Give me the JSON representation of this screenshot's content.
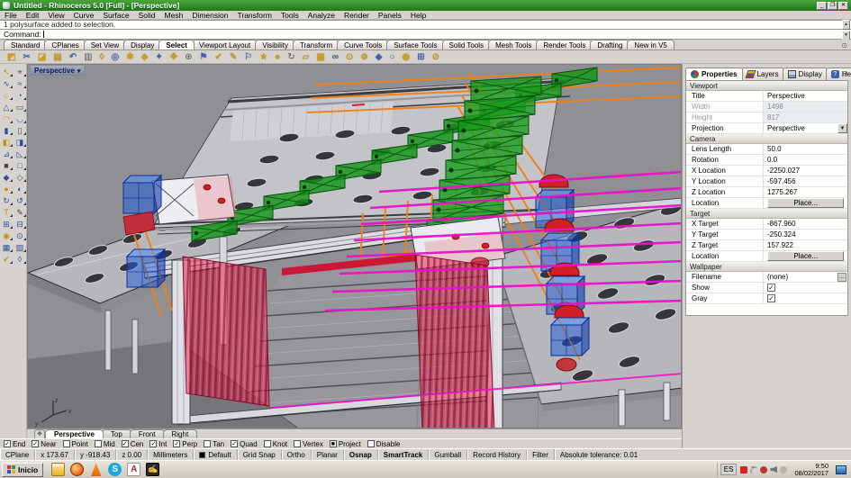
{
  "window": {
    "title": "Untitled - Rhinoceros 5.0 [Full] - [Perspective]",
    "controls": {
      "minimize": "_",
      "restore": "❐",
      "close": "✕"
    }
  },
  "menu": {
    "items": [
      "File",
      "Edit",
      "View",
      "Curve",
      "Surface",
      "Solid",
      "Mesh",
      "Dimension",
      "Transform",
      "Tools",
      "Analyze",
      "Render",
      "Panels",
      "Help"
    ]
  },
  "command": {
    "history": "1 polysurface added to selection.",
    "prompt": "Command:",
    "scroll_up": "▲",
    "scroll_down": "▼"
  },
  "toolbar_tabs": {
    "items": [
      {
        "label": "Standard"
      },
      {
        "label": "CPlanes"
      },
      {
        "label": "Set View"
      },
      {
        "label": "Display"
      },
      {
        "label": "Select",
        "active": true
      },
      {
        "label": "Viewport Layout"
      },
      {
        "label": "Visibility"
      },
      {
        "label": "Transform"
      },
      {
        "label": "Curve Tools"
      },
      {
        "label": "Surface Tools"
      },
      {
        "label": "Solid Tools"
      },
      {
        "label": "Mesh Tools"
      },
      {
        "label": "Render Tools"
      },
      {
        "label": "Drafting"
      },
      {
        "label": "New in V5"
      }
    ],
    "gear_glyph": "⊙"
  },
  "toolbar_icons": [
    {
      "name": "select-objects",
      "glyph": "◩"
    },
    {
      "name": "link-objects",
      "glyph": "✂"
    },
    {
      "name": "shade-mode",
      "glyph": "◪"
    },
    {
      "name": "open-layer-box",
      "glyph": "▤"
    },
    {
      "name": "undo",
      "glyph": "↶"
    },
    {
      "name": "clipboard",
      "glyph": "▥"
    },
    {
      "name": "gem",
      "glyph": "◊"
    },
    {
      "name": "torus",
      "glyph": "◎"
    },
    {
      "name": "color-wheel",
      "glyph": "✱"
    },
    {
      "name": "layer-state",
      "glyph": "◈"
    },
    {
      "name": "spark",
      "glyph": "✦"
    },
    {
      "name": "move",
      "glyph": "✥"
    },
    {
      "name": "snap",
      "glyph": "⊕"
    },
    {
      "name": "flag",
      "glyph": "⚑"
    },
    {
      "name": "check",
      "glyph": "✔"
    },
    {
      "name": "edit-pencil",
      "glyph": "✎"
    },
    {
      "name": "flag-outline",
      "glyph": "⚐"
    },
    {
      "name": "star",
      "glyph": "★"
    },
    {
      "name": "render-sphere",
      "glyph": "●"
    },
    {
      "name": "rotate",
      "glyph": "↻"
    },
    {
      "name": "plane",
      "glyph": "▱"
    },
    {
      "name": "notes",
      "glyph": "▣"
    },
    {
      "name": "chain-link",
      "glyph": "∞"
    },
    {
      "name": "options",
      "glyph": "⊙"
    },
    {
      "name": "gear",
      "glyph": "⊚"
    },
    {
      "name": "diamond",
      "glyph": "◆"
    },
    {
      "name": "circle",
      "glyph": "○"
    },
    {
      "name": "sphere",
      "glyph": "◉"
    },
    {
      "name": "grid-panel",
      "glyph": "⊞"
    },
    {
      "name": "filter",
      "glyph": "⊘"
    }
  ],
  "sidebar_icons": [
    {
      "name": "select-arrow",
      "glyph": "↖"
    },
    {
      "name": "selection-brush",
      "glyph": "⌖"
    },
    {
      "name": "control-point-curve",
      "glyph": "∿"
    },
    {
      "name": "sketch-curve",
      "glyph": "≈"
    },
    {
      "name": "circle-center",
      "glyph": "○"
    },
    {
      "name": "circle-arc",
      "glyph": "◔"
    },
    {
      "name": "polygon-tool",
      "glyph": "△"
    },
    {
      "name": "rectangle-tool",
      "glyph": "▭"
    },
    {
      "name": "arc-tool",
      "glyph": "◠"
    },
    {
      "name": "curve-blend",
      "glyph": "◡"
    },
    {
      "name": "box-tool",
      "glyph": "▮"
    },
    {
      "name": "rounded-box-tool",
      "glyph": "▯"
    },
    {
      "name": "cylinder-tool",
      "glyph": "◧"
    },
    {
      "name": "pipe-tool",
      "glyph": "◨"
    },
    {
      "name": "plane-tool",
      "glyph": "⊿"
    },
    {
      "name": "surface-loft",
      "glyph": "◺"
    },
    {
      "name": "extrude-surface",
      "glyph": "■"
    },
    {
      "name": "sweep-surface",
      "glyph": "□"
    },
    {
      "name": "fillet-edge",
      "glyph": "◆"
    },
    {
      "name": "chamfer-edge",
      "glyph": "◇"
    },
    {
      "name": "boolean-union",
      "glyph": "●"
    },
    {
      "name": "boolean-difference",
      "glyph": "◐"
    },
    {
      "name": "offset-curve",
      "glyph": "↻"
    },
    {
      "name": "project-curve",
      "glyph": "↺"
    },
    {
      "name": "text-object",
      "glyph": "T"
    },
    {
      "name": "point-path",
      "glyph": "✎"
    },
    {
      "name": "rect-array",
      "glyph": "⊞"
    },
    {
      "name": "polar-array",
      "glyph": "⊟"
    },
    {
      "name": "sphere-tool",
      "glyph": "◉"
    },
    {
      "name": "point-cloud",
      "glyph": "⊙"
    },
    {
      "name": "mesh-grid",
      "glyph": "▦"
    },
    {
      "name": "mesh-patch",
      "glyph": "▧"
    },
    {
      "name": "check-objects",
      "glyph": "✔"
    },
    {
      "name": "measure-angle",
      "glyph": "◊"
    }
  ],
  "viewport": {
    "title": "Perspective",
    "arrow": "▾",
    "axis": {
      "x": "x",
      "y": "y",
      "z": "z"
    },
    "tabs": [
      {
        "label": "Perspective",
        "active": true
      },
      {
        "label": "Top"
      },
      {
        "label": "Front"
      },
      {
        "label": "Right"
      }
    ],
    "new_pane_glyph": "❖"
  },
  "scene": {
    "colors": {
      "background": "#8f9094",
      "table_gray": "#b6b7bb",
      "deck_gray": "#c3c4c8",
      "floor_gray": "#96979b",
      "bracket_green": "#129618",
      "laser_magenta": "#ee10c8",
      "wire_orange": "#f08018",
      "curtain_red": "#d2143c",
      "box_blue": "#1a5adc",
      "cap_red": "#cf2025"
    }
  },
  "panel": {
    "tabs": [
      {
        "label": "Properties",
        "icon": "props",
        "active": true
      },
      {
        "label": "Layers",
        "icon": "layers"
      },
      {
        "label": "Display",
        "icon": "display"
      },
      {
        "label": "Help",
        "icon": "help"
      }
    ],
    "gear_glyph": "⊙",
    "sections": {
      "viewport": {
        "title": "Viewport",
        "rows": {
          "title": {
            "label": "Title",
            "value": "Perspective"
          },
          "width": {
            "label": "Width",
            "value": "1498"
          },
          "height": {
            "label": "Height",
            "value": "817"
          },
          "projection": {
            "label": "Projection",
            "value": "Perspective",
            "arrow": "▼"
          }
        }
      },
      "camera": {
        "title": "Camera",
        "rows": {
          "lens": {
            "label": "Lens Length",
            "value": "50.0"
          },
          "rotation": {
            "label": "Rotation",
            "value": "0.0"
          },
          "x": {
            "label": "X Location",
            "value": "-2250.027"
          },
          "y": {
            "label": "Y Location",
            "value": "-597.456"
          },
          "z": {
            "label": "Z Location",
            "value": "1275.267"
          },
          "location": {
            "label": "Location",
            "button": "Place..."
          }
        }
      },
      "target": {
        "title": "Target",
        "rows": {
          "x": {
            "label": "X Target",
            "value": "-867.960"
          },
          "y": {
            "label": "Y Target",
            "value": "-250.324"
          },
          "z": {
            "label": "Z Target",
            "value": "157.922"
          },
          "location": {
            "label": "Location",
            "button": "Place..."
          }
        }
      },
      "wallpaper": {
        "title": "Wallpaper",
        "rows": {
          "filename": {
            "label": "Filename",
            "value": "(none)",
            "browse": "..."
          },
          "show": {
            "label": "Show",
            "glyph": "✓"
          },
          "gray": {
            "label": "Gray",
            "glyph": "✓"
          }
        }
      }
    }
  },
  "osnap": {
    "items": [
      {
        "label": "End",
        "glyph": "✓"
      },
      {
        "label": "Near",
        "glyph": "✓"
      },
      {
        "label": "Point",
        "glyph": ""
      },
      {
        "label": "Mid",
        "glyph": ""
      },
      {
        "label": "Cen",
        "glyph": "✓"
      },
      {
        "label": "Int",
        "glyph": "✓"
      },
      {
        "label": "Perp",
        "glyph": "✓"
      },
      {
        "label": "Tan",
        "glyph": ""
      },
      {
        "label": "Quad",
        "glyph": "✓"
      },
      {
        "label": "Knot",
        "glyph": ""
      },
      {
        "label": "Vertex",
        "glyph": ""
      },
      {
        "label": "Project",
        "glyph": "■"
      },
      {
        "label": "Disable",
        "glyph": ""
      }
    ]
  },
  "statusbar": {
    "cplane": "CPlane",
    "x": "x 173.67",
    "y": "y -918.43",
    "z": "z 0.00",
    "units": "Millimeters",
    "layer": "Default",
    "toggles": [
      {
        "label": "Grid Snap"
      },
      {
        "label": "Ortho"
      },
      {
        "label": "Planar"
      },
      {
        "label": "Osnap",
        "bold": true
      },
      {
        "label": "SmartTrack",
        "bold": true
      },
      {
        "label": "Gumball"
      },
      {
        "label": "Record History"
      },
      {
        "label": "Filter"
      }
    ],
    "tolerance": "Absolute tolerance: 0.01"
  },
  "taskbar": {
    "start": "Inicio",
    "apps": [
      {
        "name": "explorer"
      },
      {
        "name": "firefox"
      },
      {
        "name": "vlc"
      },
      {
        "name": "skype"
      },
      {
        "name": "acrobat"
      },
      {
        "name": "rhino-document"
      }
    ],
    "tray": {
      "lang": "ES",
      "icons": [
        {
          "name": "shield"
        },
        {
          "name": "flag"
        },
        {
          "name": "alert"
        },
        {
          "name": "volume-muted"
        },
        {
          "name": "update"
        }
      ],
      "time": "9:50",
      "date": "08/02/2017"
    }
  }
}
